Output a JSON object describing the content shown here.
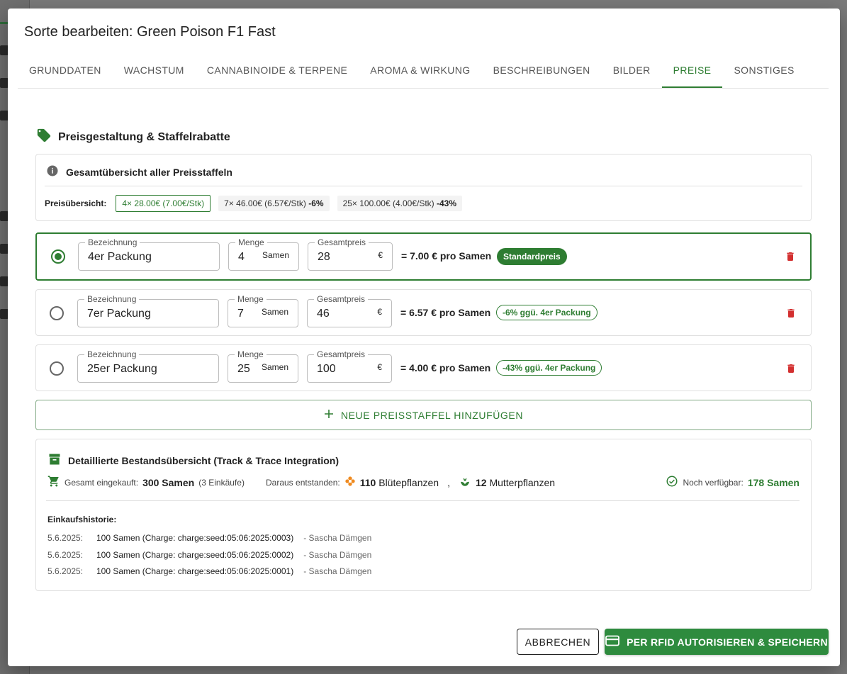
{
  "dialog": {
    "title": "Sorte bearbeiten: Green Poison F1 Fast",
    "tabs": [
      "GRUNDDATEN",
      "WACHSTUM",
      "CANNABINOIDE & TERPENE",
      "AROMA & WIRKUNG",
      "BESCHREIBUNGEN",
      "BILDER",
      "PREISE",
      "SONSTIGES"
    ],
    "active_tab": "PREISE"
  },
  "pricing": {
    "heading": "Preisgestaltung & Staffelrabatte",
    "overview": {
      "title": "Gesamtübersicht aller Preisstaffeln",
      "label": "Preisübersicht:",
      "chips": [
        {
          "text": "4× 28.00€ (7.00€/Stk)",
          "discount": ""
        },
        {
          "text": "7× 46.00€ (6.57€/Stk)",
          "discount": "-6%"
        },
        {
          "text": "25× 100.00€ (4.00€/Stk)",
          "discount": "-43%"
        }
      ]
    },
    "field_labels": {
      "name": "Bezeichnung",
      "qty": "Menge",
      "price": "Gesamtpreis",
      "unit": "Samen",
      "currency": "€"
    },
    "tiers": [
      {
        "name": "4er Packung",
        "qty": "4",
        "price": "28",
        "per_unit": "= 7.00 € pro Samen",
        "badge": "Standardpreis",
        "selected": true
      },
      {
        "name": "7er Packung",
        "qty": "7",
        "price": "46",
        "per_unit": "= 6.57 € pro Samen",
        "badge": "-6% ggü. 4er Packung",
        "selected": false
      },
      {
        "name": "25er Packung",
        "qty": "25",
        "price": "100",
        "per_unit": "= 4.00 € pro Samen",
        "badge": "-43% ggü. 4er Packung",
        "selected": false
      }
    ],
    "add_label": "NEUE PREISSTAFFEL HINZUFÜGEN"
  },
  "inventory": {
    "title": "Detaillierte Bestandsübersicht (Track & Trace Integration)",
    "purchased_label": "Gesamt eingekauft:",
    "purchased_value": "300 Samen",
    "purchased_count": "(3 Einkäufe)",
    "derived_label": "Daraus entstanden:",
    "flower_count": "110",
    "flower_label": "Blütepflanzen",
    "separator": ",",
    "mother_count": "12",
    "mother_label": "Mutterpflanzen",
    "available_label": "Noch verfügbar:",
    "available_value": "178 Samen",
    "history_title": "Einkaufshistorie:",
    "history": [
      {
        "date": "5.6.2025:",
        "amount": "100 Samen (Charge: charge:seed:05:06:2025:0003)",
        "user": "- Sascha Dämgen"
      },
      {
        "date": "5.6.2025:",
        "amount": "100 Samen (Charge: charge:seed:05:06:2025:0002)",
        "user": "- Sascha Dämgen"
      },
      {
        "date": "5.6.2025:",
        "amount": "100 Samen (Charge: charge:seed:05:06:2025:0001)",
        "user": "- Sascha Dämgen"
      }
    ]
  },
  "actions": {
    "cancel": "ABBRECHEN",
    "save": "PER RFID AUTORISIEREN & SPEICHERN"
  },
  "colors": {
    "accent": "#2e7d32",
    "danger": "#d32f2f",
    "flower": "#ef8a1f"
  }
}
